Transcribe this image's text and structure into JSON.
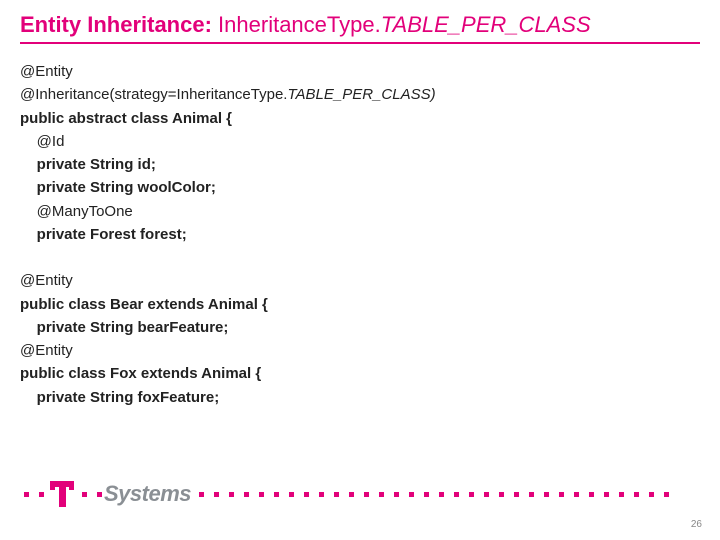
{
  "title": {
    "bold": "Entity Inheritance: ",
    "light": "InheritanceType.",
    "italic": "TABLE_PER_CLASS"
  },
  "code": {
    "l1": "@Entity",
    "l2a": "@Inheritance(strategy=InheritanceType.",
    "l2b": "TABLE_PER_CLASS)",
    "l3": "public abstract class Animal {",
    "l4": "    @Id",
    "l5": "    private String id;",
    "l6": "    private String woolColor;",
    "l7": "    @ManyToOne",
    "l8": "    private Forest forest;",
    "l9": "",
    "l10": "@Entity",
    "l11": "public class Bear extends Animal {",
    "l12": "    private String bearFeature;",
    "l13": "@Entity",
    "l14": "public class Fox extends Animal {",
    "l15": "    private String foxFeature;"
  },
  "logo": {
    "brand": "Systems"
  },
  "page": {
    "number": "26"
  }
}
